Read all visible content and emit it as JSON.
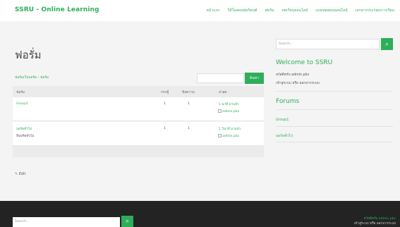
{
  "header": {
    "brand": "SSRU - Online Learning",
    "nav": [
      "หน้าแรก",
      "วิดีโอสอนฟอรัมนต์",
      "ฟอรัม",
      "บทเรียนออนไลน์",
      "แบบทดสอบออนไลน์",
      "เอกสารประกอบการเรียน"
    ]
  },
  "main": {
    "title": "ฟอรั่ม",
    "breadcrumb": [
      "ฟอรัมเว็บบอร์ด",
      "ฟอรัม"
    ],
    "search_button": "ค้นหา",
    "columns": [
      "ฟอรัม",
      "กระทู้",
      "ข้อความ",
      "ล่าสุด"
    ],
    "rows": [
      {
        "name": "Group1",
        "desc": "",
        "topics": "1",
        "posts": "1",
        "latest": "1 นาที มาแล้ว",
        "user": "admin.pkx"
      },
      {
        "name": "บอร์ดทั่วไป",
        "desc": "ฟีบอร์ดทั่วไป",
        "topics": "1",
        "posts": "1",
        "latest": "1 วินาที มาแล้ว",
        "user": "admin.pkx"
      }
    ],
    "edit_label": "Edit"
  },
  "sidebar": {
    "search_placeholder": "Search...",
    "welcome_title": "Welcome to SSRU",
    "welcome_text": "สวัสดีครับ admin.pkx",
    "welcome_links": "เข้าสู่ระบบ หรือ ออกจากระบบ",
    "forums_title": "Forums",
    "forums": [
      "Group1",
      "บอร์ดทั่วไป"
    ]
  },
  "footer": {
    "search_placeholder": "Search...",
    "right_line1": "สวัสดีครับ admin.pkx",
    "right_line2": "เข้าสู่ระบบ หรือ ออกจากระบบ"
  },
  "colors": {
    "accent": "#2eae5a",
    "footer_bg": "#232323"
  }
}
